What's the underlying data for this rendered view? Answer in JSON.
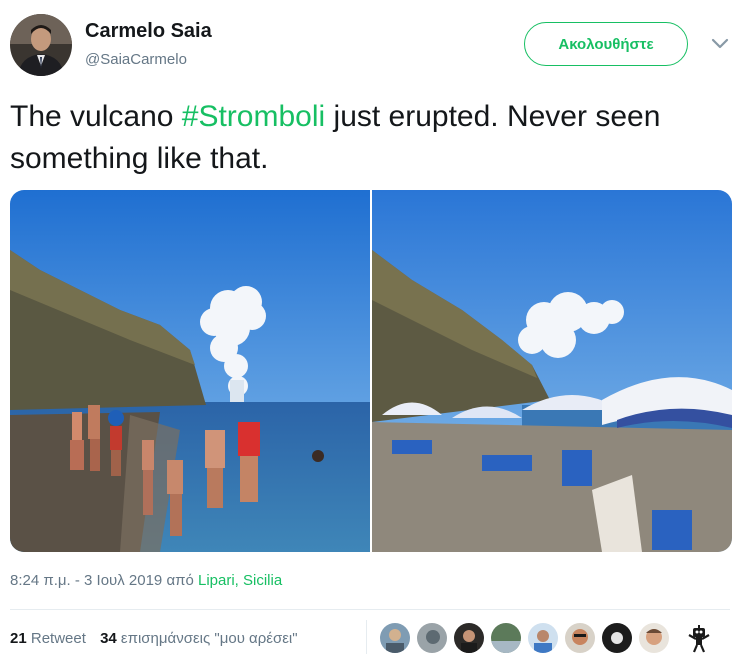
{
  "author": {
    "name": "Carmelo Saia",
    "handle": "@SaiaCarmelo",
    "follow_label": "Ακολουθήστε"
  },
  "tweet": {
    "text_before": "The vulcano ",
    "hashtag": "#Stromboli",
    "text_after": " just erupted. Never seen something like that."
  },
  "meta": {
    "timestamp": "8:24 π.μ. - 3 Ιουλ 2019 από ",
    "location": "Lipari, Sicilia"
  },
  "stats": {
    "retweet_count": "21",
    "retweet_label": "Retweet",
    "likes_count": "34",
    "likes_label": "επισημάνσεις \"μου αρέσει\""
  },
  "colors": {
    "accent": "#17bf63",
    "muted": "#657786",
    "text": "#14171a",
    "divider": "#e6ecf0"
  },
  "icons": {
    "menu": "chevron-down-icon",
    "last_liker": "robot-icon"
  }
}
